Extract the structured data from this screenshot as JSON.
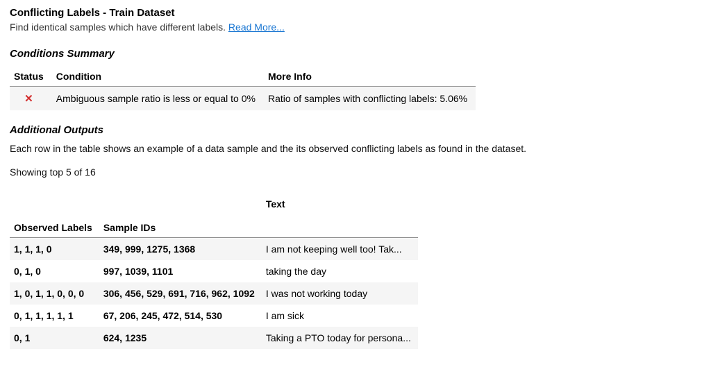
{
  "header": {
    "title": "Conflicting Labels - Train Dataset",
    "subtitle": "Find identical samples which have different labels. ",
    "read_more_label": "Read More..."
  },
  "conditions": {
    "heading": "Conditions Summary",
    "columns": {
      "status": "Status",
      "condition": "Condition",
      "more_info": "More Info"
    },
    "rows": [
      {
        "status_icon": "✕",
        "condition": "Ambiguous sample ratio is less or equal to 0%",
        "more_info": "Ratio of samples with conflicting labels: 5.06%"
      }
    ]
  },
  "outputs": {
    "heading": "Additional Outputs",
    "description": "Each row in the table shows an example of a data sample and the its observed conflicting labels as found in the dataset.",
    "showing": "Showing top 5 of 16",
    "top_header": "Text",
    "columns": {
      "labels": "Observed Labels",
      "ids": "Sample IDs"
    },
    "rows": [
      {
        "labels": "1, 1, 1, 0",
        "ids": "349, 999, 1275, 1368",
        "text": "I am not keeping well too! Tak..."
      },
      {
        "labels": "0, 1, 0",
        "ids": "997, 1039, 1101",
        "text": "taking the day"
      },
      {
        "labels": "1, 0, 1, 1, 0, 0, 0",
        "ids": "306, 456, 529, 691, 716, 962, 1092",
        "text": "I was not working today"
      },
      {
        "labels": "0, 1, 1, 1, 1, 1",
        "ids": "67, 206, 245, 472, 514, 530",
        "text": "I am sick"
      },
      {
        "labels": "0, 1",
        "ids": "624, 1235",
        "text": "Taking a PTO today for persona..."
      }
    ]
  }
}
